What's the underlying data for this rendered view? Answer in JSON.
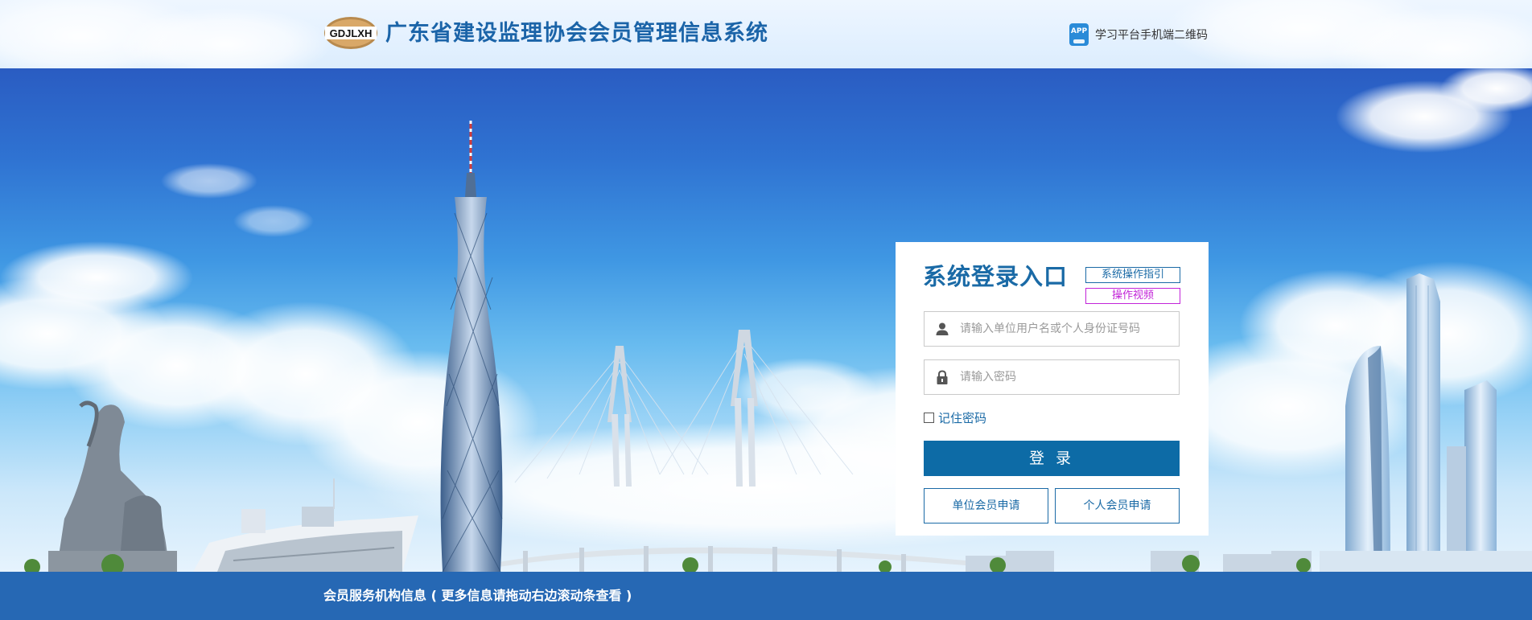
{
  "header": {
    "logo_text": "GDJLXH",
    "site_title": "广东省建设监理协会会员管理信息系统",
    "app_icon_text": "APP",
    "app_link_label": "学习平台手机端二维码"
  },
  "login": {
    "title": "系统登录入口",
    "guide_label": "系统操作指引",
    "video_label": "操作视频",
    "username_placeholder": "请输入单位用户名或个人身份证号码",
    "username_value": "",
    "password_placeholder": "请输入密码",
    "password_value": "",
    "remember_label": "记住密码",
    "remember_checked": false,
    "login_button": "登 录",
    "unit_apply_button": "单位会员申请",
    "personal_apply_button": "个人会员申请"
  },
  "footer": {
    "info_text": "会员服务机构信息 ( 更多信息请拖动右边滚动条查看 )"
  },
  "icons": {
    "user": "user-icon",
    "lock": "lock-icon",
    "app": "app-icon"
  },
  "colors": {
    "primary": "#0d6ba6",
    "title_blue": "#1a6aa6",
    "video_link": "#c223d8",
    "footer_bar": "#2668b4"
  }
}
